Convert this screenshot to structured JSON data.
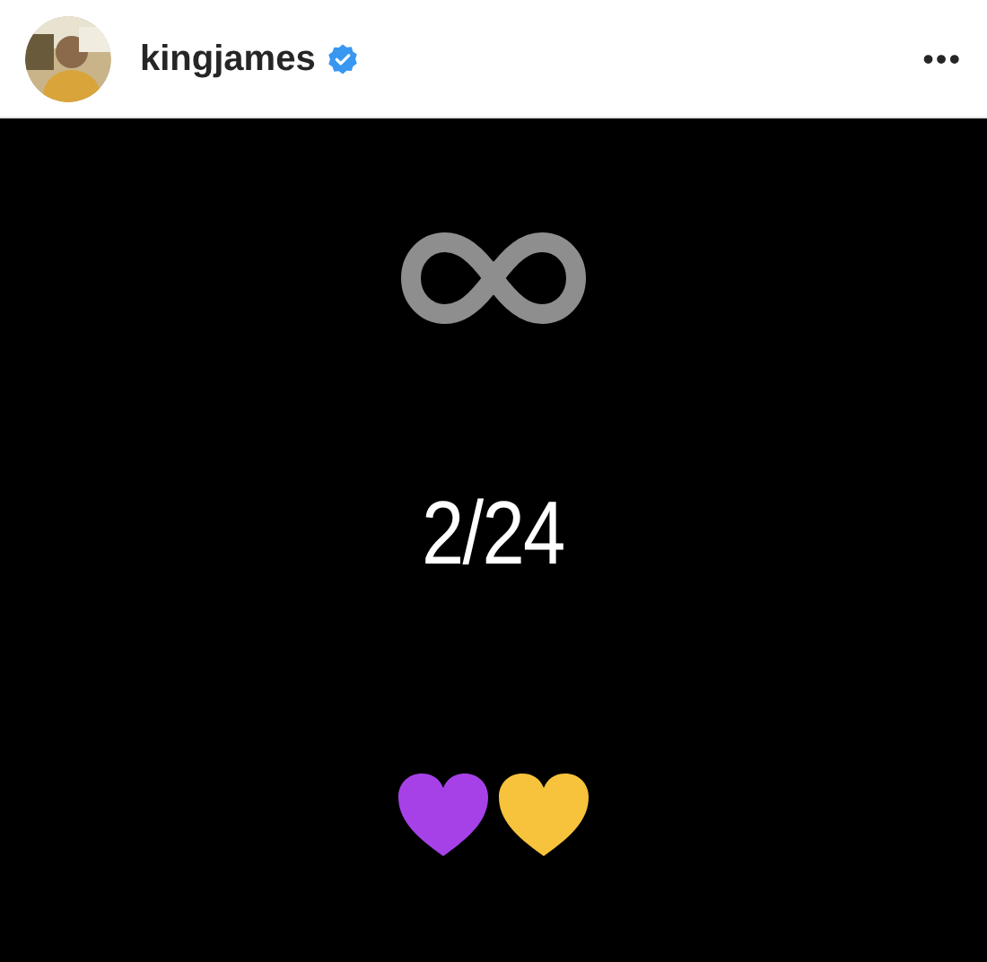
{
  "header": {
    "username": "kingjames",
    "verified": true,
    "menu": "•••"
  },
  "post": {
    "caption": "2/24",
    "hearts": [
      {
        "color": "#a641e8"
      },
      {
        "color": "#f7c23c"
      }
    ]
  }
}
